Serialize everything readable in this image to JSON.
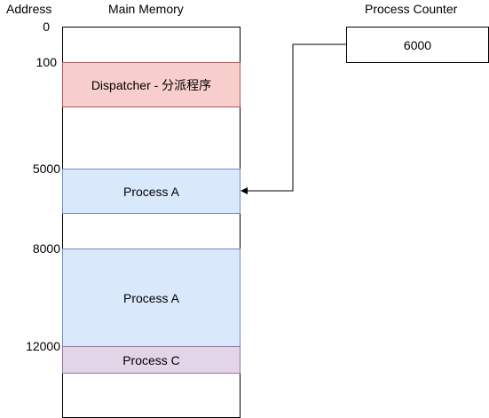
{
  "headers": {
    "address": "Address",
    "main_memory": "Main Memory",
    "process_counter": "Process Counter"
  },
  "addresses": [
    "0",
    "100",
    "5000",
    "8000",
    "12000"
  ],
  "segments": {
    "dispatcher": "Dispatcher - 分派程序",
    "process_a_1": "Process A",
    "process_a_2": "Process A",
    "process_c": "Process C"
  },
  "process_counter": {
    "value": "6000"
  },
  "colors": {
    "dispatcher_fill": "#f8cecc",
    "dispatcher_border": "#b85450",
    "process_a_fill": "#dae8fc",
    "process_a_border": "#6c8ebf",
    "process_c_fill": "#e1d5e7",
    "process_c_border": "#9673a6"
  }
}
